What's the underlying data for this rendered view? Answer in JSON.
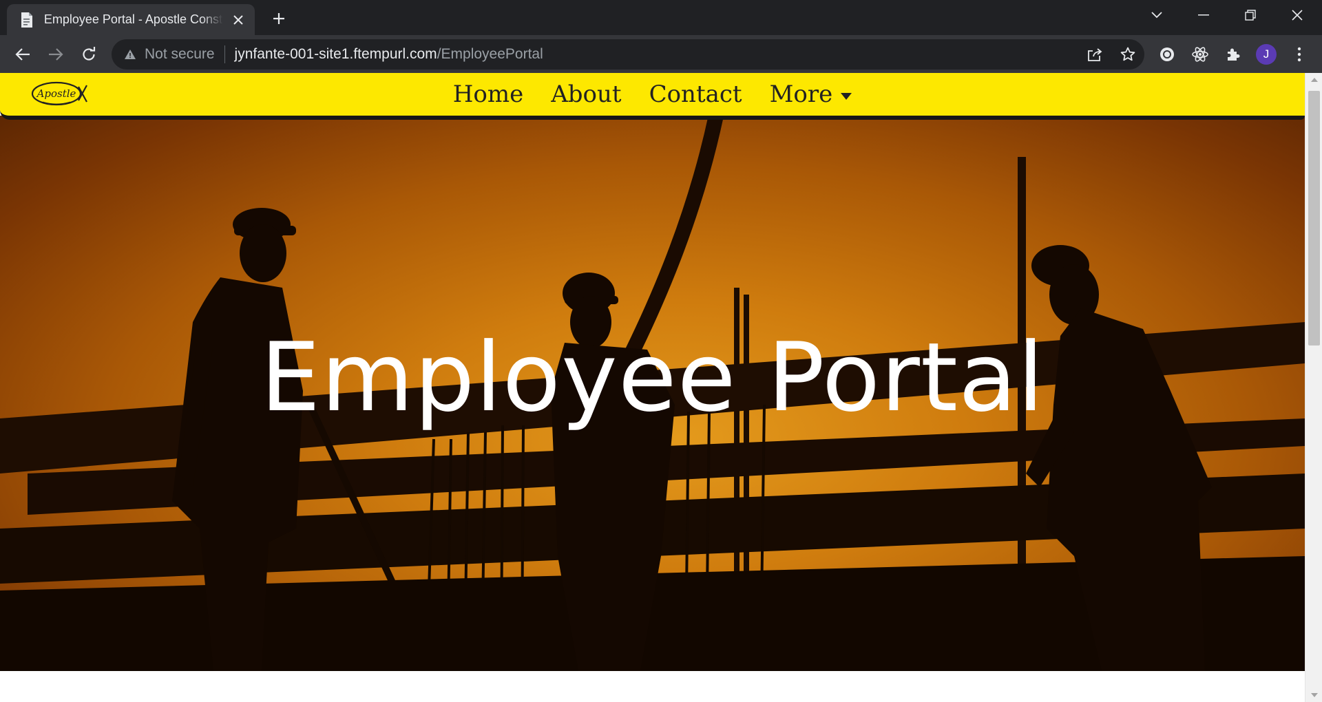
{
  "browser": {
    "tab": {
      "title": "Employee Portal - Apostle Construction",
      "favicon": "document-icon"
    },
    "address_bar": {
      "security_label": "Not secure",
      "host": "jynfante-001-site1.ftempurl.com",
      "path": "/EmployeePortal"
    },
    "profile_initial": "J",
    "colors": {
      "frame": "#202124",
      "toolbar": "#35363a",
      "avatar": "#5b3bb4"
    }
  },
  "site": {
    "logo_alt": "Apostle",
    "nav": [
      {
        "label": "Home"
      },
      {
        "label": "About"
      },
      {
        "label": "Contact"
      },
      {
        "label": "More"
      }
    ],
    "hero_title": "Employee Portal",
    "colors": {
      "navbar": "#fde800",
      "hero_accent": "#cf7c0e",
      "hero_text": "#ffffff"
    }
  }
}
